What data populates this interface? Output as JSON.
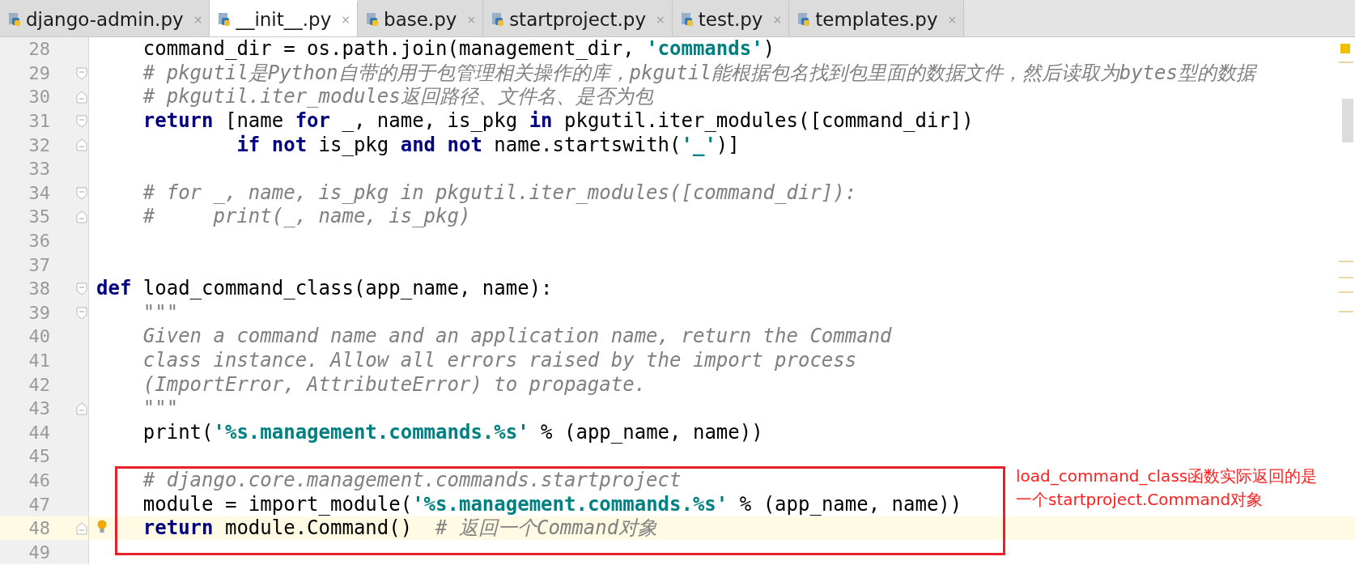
{
  "tabs": [
    {
      "label": "django-admin.py",
      "close": "×",
      "selected": false
    },
    {
      "label": "__init__.py",
      "close": "×",
      "selected": true
    },
    {
      "label": "base.py",
      "close": "×",
      "selected": false
    },
    {
      "label": "startproject.py",
      "close": "×",
      "selected": false
    },
    {
      "label": "test.py",
      "close": "×",
      "selected": false
    },
    {
      "label": "templates.py",
      "close": "×",
      "selected": false
    }
  ],
  "editor": {
    "lines": [
      {
        "number": "28",
        "current": false,
        "fold_start": false,
        "fold_end": false,
        "segments": [
          {
            "kind": "plain",
            "text": "    command_dir = os.path.join(management_dir, "
          },
          {
            "kind": "string",
            "text": "'commands'"
          },
          {
            "kind": "plain",
            "text": ")"
          }
        ]
      },
      {
        "number": "29",
        "current": false,
        "fold_start": true,
        "fold_end": false,
        "segments": [
          {
            "kind": "comment",
            "text": "    # pkgutil是Python自带的用于包管理相关操作的库，pkgutil能根据包名找到包里面的数据文件，然后读取为bytes型的数据"
          }
        ]
      },
      {
        "number": "30",
        "current": false,
        "fold_start": false,
        "fold_end": true,
        "segments": [
          {
            "kind": "comment",
            "text": "    # pkgutil.iter_modules返回路径、文件名、是否为包"
          }
        ]
      },
      {
        "number": "31",
        "current": false,
        "fold_start": true,
        "fold_end": false,
        "segments": [
          {
            "kind": "keyword",
            "text": "    return"
          },
          {
            "kind": "plain",
            "text": " [name "
          },
          {
            "kind": "keyword",
            "text": "for"
          },
          {
            "kind": "plain",
            "text": " _, name, is_pkg "
          },
          {
            "kind": "keyword",
            "text": "in"
          },
          {
            "kind": "plain",
            "text": " pkgutil.iter_modules([command_dir])"
          }
        ]
      },
      {
        "number": "32",
        "current": false,
        "fold_start": false,
        "fold_end": true,
        "segments": [
          {
            "kind": "keyword",
            "text": "            if not"
          },
          {
            "kind": "plain",
            "text": " is_pkg "
          },
          {
            "kind": "keyword",
            "text": "and not"
          },
          {
            "kind": "plain",
            "text": " name.startswith("
          },
          {
            "kind": "string",
            "text": "'_'"
          },
          {
            "kind": "plain",
            "text": ")]"
          }
        ]
      },
      {
        "number": "33",
        "current": false,
        "fold_start": false,
        "fold_end": false
      },
      {
        "number": "34",
        "current": false,
        "fold_start": true,
        "fold_end": false,
        "segments": [
          {
            "kind": "comment",
            "text": "    # for _, name, is_pkg in pkgutil.iter_modules([command_dir]):"
          }
        ]
      },
      {
        "number": "35",
        "current": false,
        "fold_start": false,
        "fold_end": true,
        "segments": [
          {
            "kind": "comment",
            "text": "    #     print(_, name, is_pkg)"
          }
        ]
      },
      {
        "number": "36",
        "current": false,
        "fold_start": false,
        "fold_end": false
      },
      {
        "number": "37",
        "current": false,
        "fold_start": false,
        "fold_end": false
      },
      {
        "number": "38",
        "current": false,
        "fold_start": true,
        "fold_end": false,
        "segments": [
          {
            "kind": "keyword",
            "text": "def"
          },
          {
            "kind": "plain",
            "text": " load_command_class(app_name, name):"
          }
        ]
      },
      {
        "number": "39",
        "current": false,
        "fold_start": true,
        "fold_end": false,
        "segments": [
          {
            "kind": "doc",
            "text": "    \"\"\""
          }
        ]
      },
      {
        "number": "40",
        "current": false,
        "fold_start": false,
        "fold_end": false,
        "segments": [
          {
            "kind": "doc",
            "text": "    Given a command name and an application name, return the Command"
          }
        ]
      },
      {
        "number": "41",
        "current": false,
        "fold_start": false,
        "fold_end": false,
        "segments": [
          {
            "kind": "doc",
            "text": "    class instance. Allow all errors raised by the import process"
          }
        ]
      },
      {
        "number": "42",
        "current": false,
        "fold_start": false,
        "fold_end": false,
        "segments": [
          {
            "kind": "doc",
            "text": "    (ImportError, AttributeError) to propagate."
          }
        ]
      },
      {
        "number": "43",
        "current": false,
        "fold_start": false,
        "fold_end": true,
        "segments": [
          {
            "kind": "doc",
            "text": "    \"\"\""
          }
        ]
      },
      {
        "number": "44",
        "current": false,
        "fold_start": false,
        "fold_end": false,
        "segments": [
          {
            "kind": "plain",
            "text": "    print("
          },
          {
            "kind": "string",
            "text": "'%s.management.commands.%s'"
          },
          {
            "kind": "plain",
            "text": " % (app_name, name))"
          }
        ]
      },
      {
        "number": "45",
        "current": false,
        "fold_start": false,
        "fold_end": false
      },
      {
        "number": "46",
        "current": false,
        "fold_start": false,
        "fold_end": false,
        "segments": [
          {
            "kind": "comment",
            "text": "    # django.core.management.commands.startproject"
          }
        ]
      },
      {
        "number": "47",
        "current": false,
        "fold_start": false,
        "fold_end": false,
        "segments": [
          {
            "kind": "plain",
            "text": "    module = import_module("
          },
          {
            "kind": "string",
            "text": "'%s.management.commands.%s'"
          },
          {
            "kind": "plain",
            "text": " % (app_name, name))"
          }
        ]
      },
      {
        "number": "48",
        "current": true,
        "fold_start": false,
        "fold_end": true,
        "segments": [
          {
            "kind": "keyword",
            "text": "    return"
          },
          {
            "kind": "plain",
            "text": " module.Command()  "
          },
          {
            "kind": "comment",
            "text": "# 返回一个Command对象"
          }
        ]
      },
      {
        "number": "49",
        "current": false,
        "fold_start": false,
        "fold_end": false
      }
    ]
  },
  "annotation": {
    "text": "load_command_class函数实际返回的是一个startproject.Command对象"
  }
}
